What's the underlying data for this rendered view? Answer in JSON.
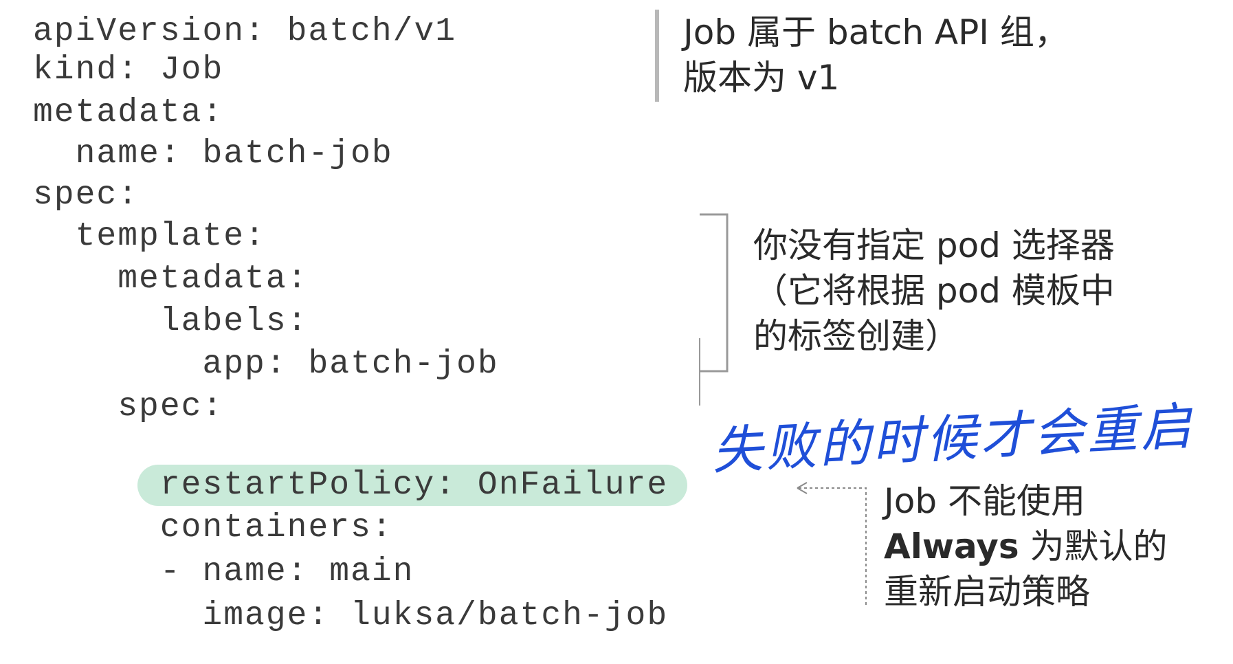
{
  "code_lines": [
    "apiVersion: batch/v1",
    "kind: Job",
    "metadata:",
    "  name: batch-job",
    "spec:",
    "  template:",
    "    metadata:",
    "      labels:",
    "        app: batch-job",
    "    spec:",
    "      restartPolicy: OnFailure",
    "      containers:",
    "      - name: main",
    "        image: luksa/batch-job"
  ],
  "annotations": {
    "api_group": [
      "Job 属于 batch API 组，",
      "版本为 v1"
    ],
    "pod_selector": [
      "你没有指定 pod 选择器",
      "（它将根据 pod 模板中",
      "的标签创建）"
    ],
    "restart_policy": [
      "Job 不能使用",
      "Always 为默认的",
      "重新启动策略"
    ]
  },
  "handwritten_note": "失败的时候才会重启",
  "colors": {
    "highlight": "#c9ead9",
    "handwriting": "#1f4fd8",
    "code_text": "#3a3a3a"
  }
}
